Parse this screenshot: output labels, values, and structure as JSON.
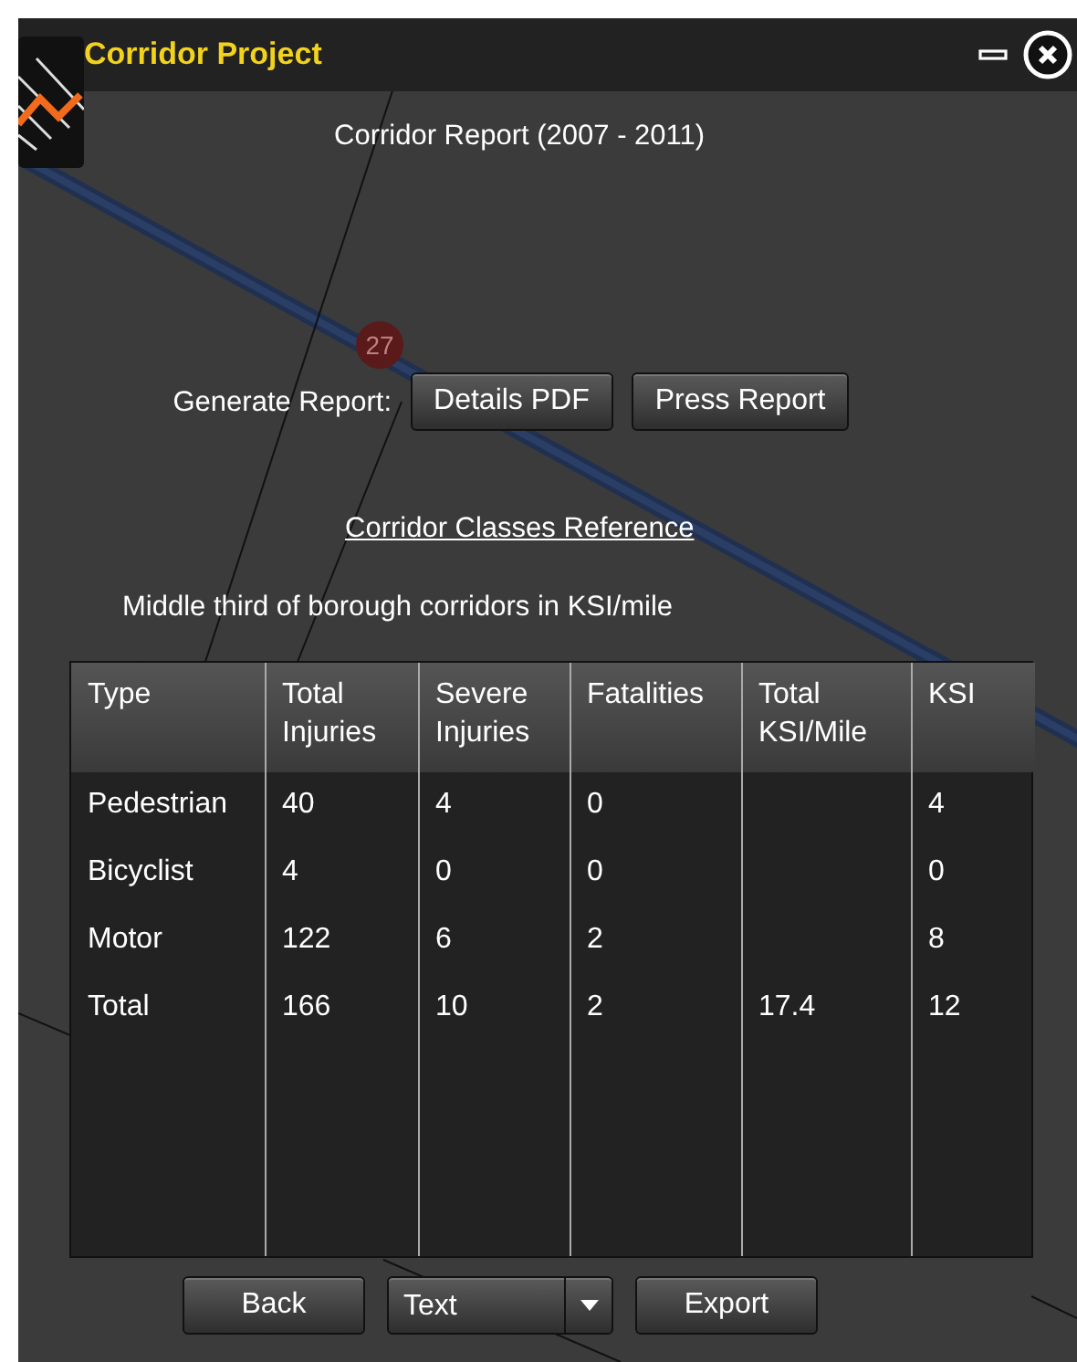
{
  "window": {
    "title": "Corridor Project"
  },
  "report_title": "Corridor Report (2007 - 2011)",
  "map_marker": {
    "label": "27"
  },
  "generate": {
    "label": "Generate Report:",
    "buttons": [
      "Details PDF",
      "Press Report"
    ]
  },
  "link": "Corridor Classes Reference",
  "description": "Middle third of borough corridors in KSI/mile",
  "table": {
    "columns": [
      "Type",
      "Total Injuries",
      "Severe Injuries",
      "Fatalities",
      "Total KSI/Mile",
      "KSI"
    ],
    "rows": [
      [
        "Pedestrian",
        "40",
        "4",
        "0",
        null,
        "4"
      ],
      [
        "Bicyclist",
        "4",
        "0",
        "0",
        null,
        "0"
      ],
      [
        "Motor",
        "122",
        "6",
        "2",
        null,
        "8"
      ],
      [
        "Total",
        "166",
        "10",
        "2",
        "17.4",
        "12"
      ]
    ]
  },
  "footer": {
    "back": "Back",
    "format": {
      "value": "Text"
    },
    "export": "Export"
  }
}
